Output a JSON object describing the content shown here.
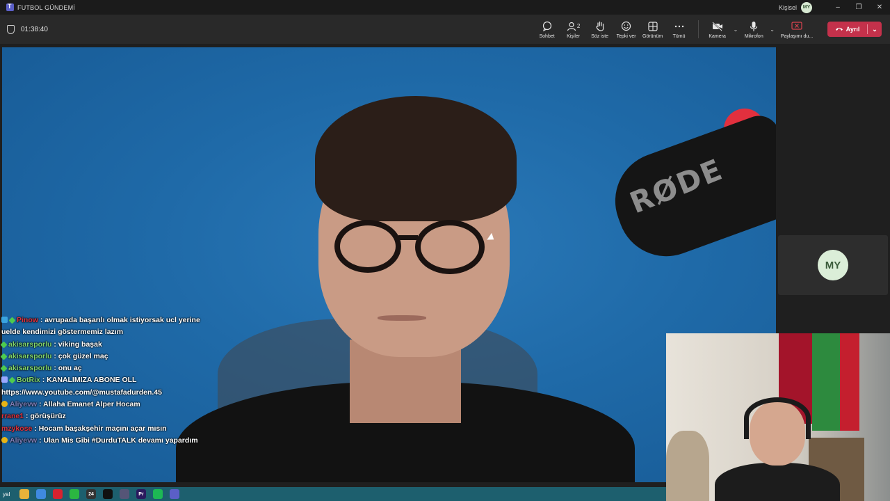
{
  "window": {
    "title": "FUTBOL GÜNDEMİ",
    "profile_label": "Kişisel",
    "profile_initials": "MY",
    "controls": {
      "minimize": "–",
      "restore": "❐",
      "close": "✕"
    }
  },
  "meeting": {
    "timer": "01:38:40"
  },
  "toolbar": {
    "chat": {
      "label": "Sohbet",
      "icon": "chat-icon"
    },
    "people": {
      "label": "Kişiler",
      "count": "2",
      "icon": "people-icon"
    },
    "raise_hand": {
      "label": "Söz iste",
      "icon": "hand-icon"
    },
    "react": {
      "label": "Tepki ver",
      "icon": "smile-icon"
    },
    "view": {
      "label": "Görünüm",
      "icon": "grid-icon"
    },
    "more": {
      "label": "Tümü",
      "icon": "more-icon"
    },
    "camera": {
      "label": "Kamera",
      "icon": "camera-off-icon"
    },
    "mic": {
      "label": "Mikrofon",
      "icon": "mic-icon"
    },
    "share": {
      "label": "Paylaşımı du...",
      "icon": "stop-share-icon"
    },
    "leave": {
      "label": "Ayrıl",
      "icon": "phone-hangup-icon"
    }
  },
  "main_video": {
    "mic_brand": "RØDE"
  },
  "side_participant": {
    "initials": "MY"
  },
  "chat_overlay": [
    {
      "badges": [
        "blue",
        "green"
      ],
      "user": "Pinow",
      "user_color": "red",
      "text": ": avrupada başarılı olmak istiyorsak ucl yerine"
    },
    {
      "badges": [],
      "user": "",
      "user_color": "",
      "text": "uelde kendimizi göstermemiz lazım"
    },
    {
      "badges": [
        "green"
      ],
      "user": "akisarsporlu",
      "user_color": "green",
      "text": ": viking başak"
    },
    {
      "badges": [
        "green"
      ],
      "user": "akisarsporlu",
      "user_color": "green",
      "text": ": çok güzel maç"
    },
    {
      "badges": [
        "green"
      ],
      "user": "akisarsporlu",
      "user_color": "green",
      "text": ": onu aç"
    },
    {
      "badges": [
        "tool",
        "green"
      ],
      "user": "BotRix",
      "user_color": "green",
      "text": ": KANALIMIZA ABONE OLL"
    },
    {
      "badges": [],
      "user": "",
      "user_color": "",
      "text": "https://www.youtube.com/@mustafadurden.45"
    },
    {
      "badges": [
        "yellow"
      ],
      "user": "Aliyevw",
      "user_color": "grey",
      "text": ": Allaha Emanet Alper Hocam"
    },
    {
      "badges": [],
      "user": "rrane1",
      "user_color": "red",
      "text": ": görüşürüz"
    },
    {
      "badges": [],
      "user": "mzykose",
      "user_color": "red",
      "text": ": Hocam başakşehir maçını açar mısın"
    },
    {
      "badges": [
        "yellow"
      ],
      "user": "Aliyevw",
      "user_color": "grey",
      "text": ": Ulan Mis Gibi #DurduTALK devamı yapardım"
    }
  ],
  "taskbar": {
    "start_label": "yal",
    "apps": [
      {
        "icon": "folder-icon",
        "color": "#e8b23a",
        "glyph": ""
      },
      {
        "icon": "chrome-icon",
        "color": "#3f8ae0",
        "glyph": ""
      },
      {
        "icon": "opera-icon",
        "color": "#d8222f",
        "glyph": ""
      },
      {
        "icon": "whatsapp-icon",
        "color": "#2bb741",
        "glyph": ""
      },
      {
        "icon": "app-24-icon",
        "color": "#333333",
        "glyph": "24"
      },
      {
        "icon": "tiktok-icon",
        "color": "#111111",
        "glyph": ""
      },
      {
        "icon": "browser-icon",
        "color": "#555577",
        "glyph": ""
      },
      {
        "icon": "premiere-icon",
        "color": "#2a1a5e",
        "glyph": "Pr"
      },
      {
        "icon": "spotify-icon",
        "color": "#1db954",
        "glyph": ""
      },
      {
        "icon": "teams-icon",
        "color": "#5b5fc7",
        "glyph": ""
      }
    ]
  }
}
